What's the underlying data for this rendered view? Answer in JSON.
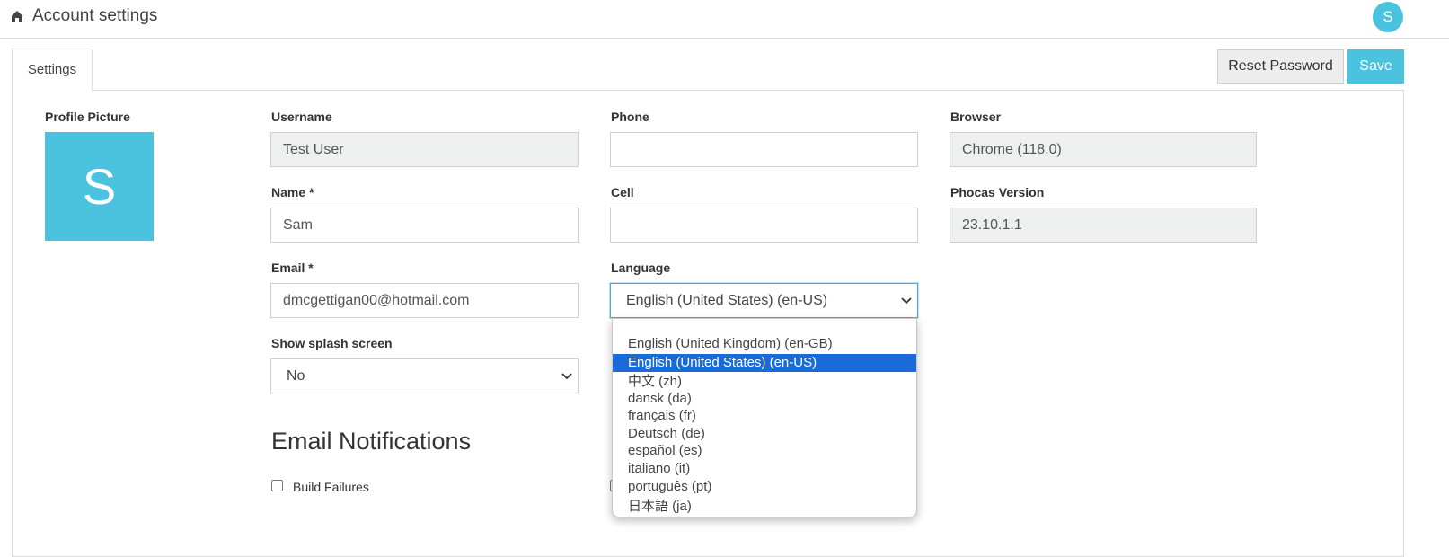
{
  "header": {
    "title": "Account settings",
    "avatar_initial": "S"
  },
  "tabs": [
    {
      "label": "Settings"
    }
  ],
  "actions": {
    "reset_password": "Reset Password",
    "save": "Save"
  },
  "profile": {
    "label": "Profile Picture",
    "initial": "S"
  },
  "form": {
    "username": {
      "label": "Username",
      "value": "Test User"
    },
    "name": {
      "label": "Name *",
      "value": "Sam"
    },
    "email": {
      "label": "Email *",
      "value": "dmcgettigan00@hotmail.com"
    },
    "splash": {
      "label": "Show splash screen",
      "value": "No"
    },
    "phone": {
      "label": "Phone",
      "value": ""
    },
    "cell": {
      "label": "Cell",
      "value": ""
    },
    "language": {
      "label": "Language",
      "value": "English (United States) (en-US)"
    },
    "browser": {
      "label": "Browser",
      "value": "Chrome (118.0)"
    },
    "version": {
      "label": "Phocas Version",
      "value": "23.10.1.1"
    }
  },
  "notifications": {
    "title": "Email Notifications",
    "build_failures": "Build Failures"
  },
  "language_options": [
    {
      "label": "English (United Kingdom) (en-GB)",
      "selected": false
    },
    {
      "label": "English (United States) (en-US)",
      "selected": true
    },
    {
      "label": "中文 (zh)",
      "selected": false
    },
    {
      "label": "dansk (da)",
      "selected": false
    },
    {
      "label": "français (fr)",
      "selected": false
    },
    {
      "label": "Deutsch (de)",
      "selected": false
    },
    {
      "label": "español (es)",
      "selected": false
    },
    {
      "label": "italiano (it)",
      "selected": false
    },
    {
      "label": "português (pt)",
      "selected": false
    },
    {
      "label": "日本語 (ja)",
      "selected": false
    }
  ],
  "colors": {
    "accent": "#4cc3de",
    "selection": "#1a6ad8"
  }
}
